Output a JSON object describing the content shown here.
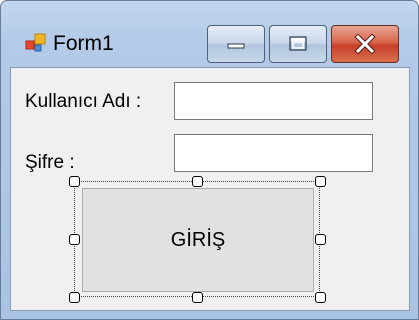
{
  "window": {
    "title": "Form1",
    "app_icon": "winforms-form-icon",
    "caption_buttons": {
      "minimize_icon": "minimize-icon",
      "maximize_icon": "maximize-icon",
      "close_icon": "close-icon"
    }
  },
  "form": {
    "username_label": "Kullanıcı Adı :",
    "username_value": "",
    "password_label": "Şifre :",
    "password_value": "",
    "login_button_label": "GİRİŞ"
  },
  "colors": {
    "close_button": "#c7402a",
    "client_background": "#f0f0f0",
    "button_face": "#e1e1e1"
  }
}
